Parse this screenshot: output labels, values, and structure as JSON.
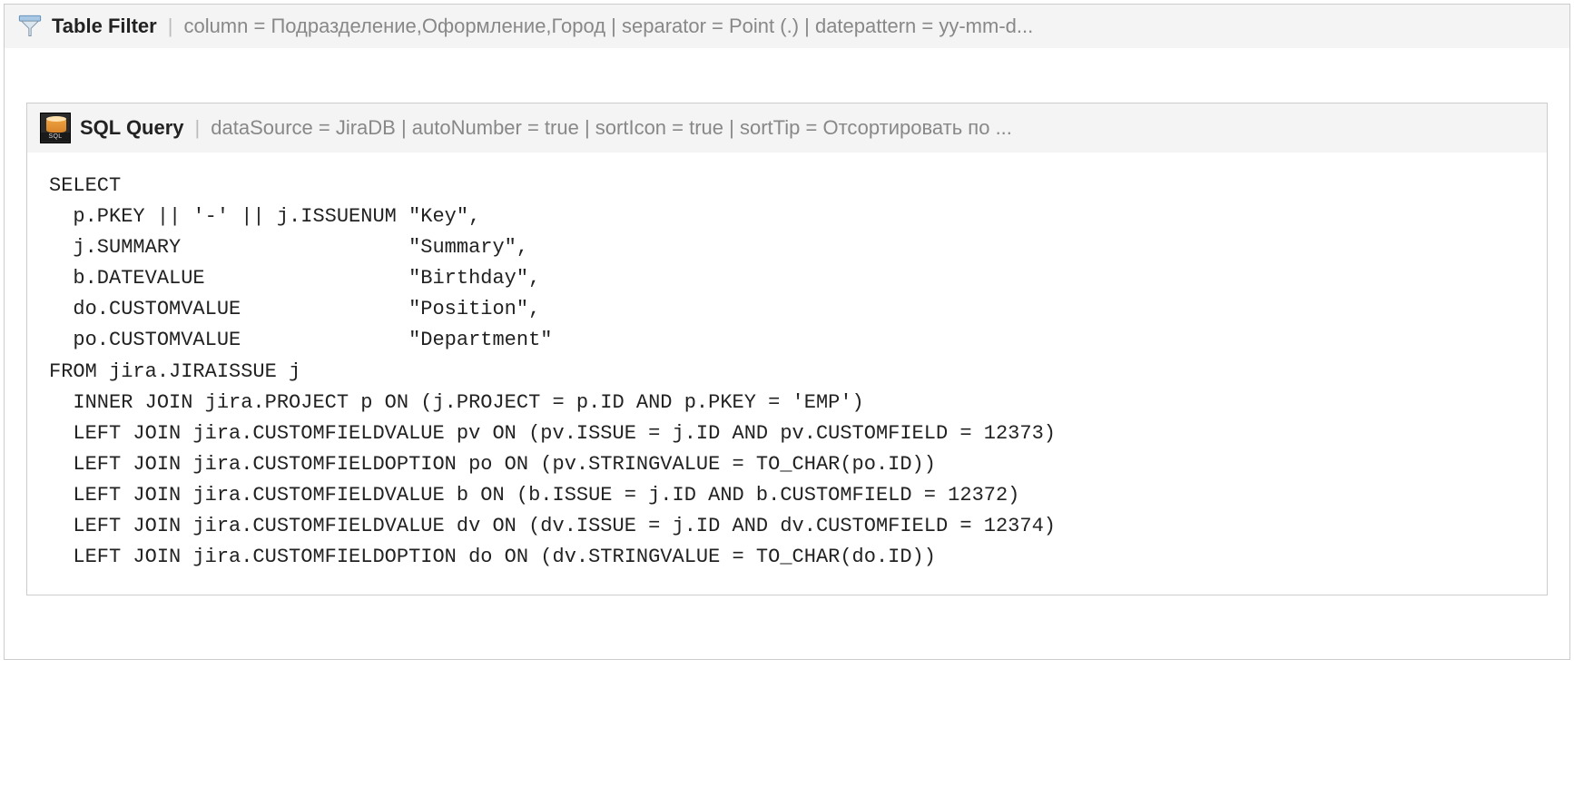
{
  "outerMacro": {
    "title": "Table Filter",
    "params": "column = Подразделение,Оформление,Город | separator = Point (.) | datepattern = yy-mm-d..."
  },
  "innerMacro": {
    "title": "SQL Query",
    "params": "dataSource = JiraDB | autoNumber = true | sortIcon = true | sortTip = Отсортировать по ...",
    "iconLabel": "SQL"
  },
  "sql": "SELECT\n  p.PKEY || '-' || j.ISSUENUM \"Key\",\n  j.SUMMARY                   \"Summary\",\n  b.DATEVALUE                 \"Birthday\",\n  do.CUSTOMVALUE              \"Position\",\n  po.CUSTOMVALUE              \"Department\"\nFROM jira.JIRAISSUE j\n  INNER JOIN jira.PROJECT p ON (j.PROJECT = p.ID AND p.PKEY = 'EMP')\n  LEFT JOIN jira.CUSTOMFIELDVALUE pv ON (pv.ISSUE = j.ID AND pv.CUSTOMFIELD = 12373)\n  LEFT JOIN jira.CUSTOMFIELDOPTION po ON (pv.STRINGVALUE = TO_CHAR(po.ID))\n  LEFT JOIN jira.CUSTOMFIELDVALUE b ON (b.ISSUE = j.ID AND b.CUSTOMFIELD = 12372)\n  LEFT JOIN jira.CUSTOMFIELDVALUE dv ON (dv.ISSUE = j.ID AND dv.CUSTOMFIELD = 12374)\n  LEFT JOIN jira.CUSTOMFIELDOPTION do ON (dv.STRINGVALUE = TO_CHAR(do.ID))"
}
